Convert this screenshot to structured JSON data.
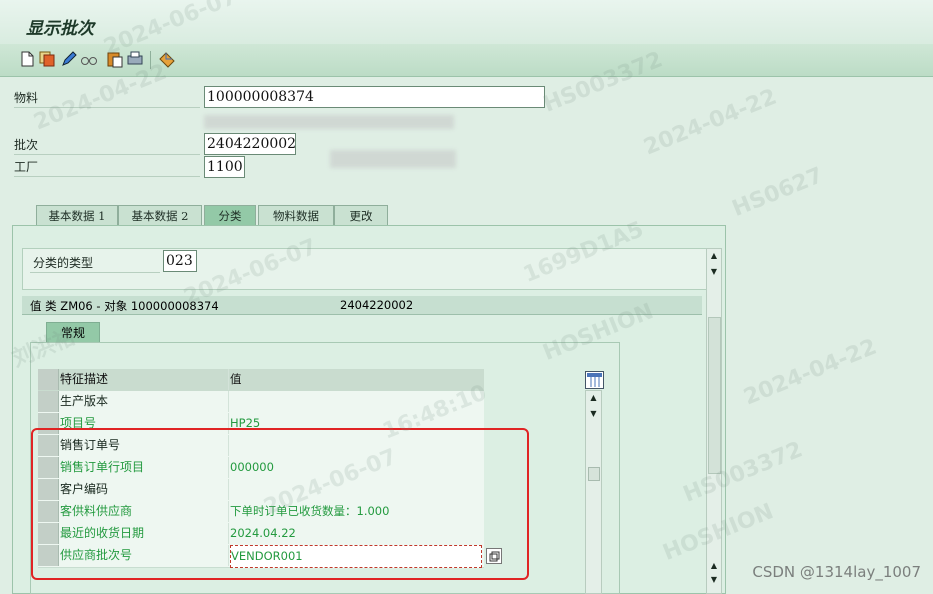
{
  "window": {
    "title": "显示批次"
  },
  "toolbar": {
    "icons": [
      "new-document-icon",
      "copy-icon",
      "pencil-edit-icon",
      "glasses-display-icon",
      "paste-icon",
      "print-icon",
      "transport-icon"
    ]
  },
  "fields": {
    "material": {
      "label": "物料",
      "value": "100000008374"
    },
    "batch": {
      "label": "批次",
      "value": "2404220002"
    },
    "plant": {
      "label": "工厂",
      "value": "1100"
    }
  },
  "tabs": [
    {
      "label": "基本数据 1"
    },
    {
      "label": "基本数据 2"
    },
    {
      "label": "分类"
    },
    {
      "label": "物料数据"
    },
    {
      "label": "更改"
    }
  ],
  "classification": {
    "class_type_label": "分类的类型",
    "class_type_value": "023",
    "object_header_left": "值 类 ZM06 - 对象 100000008374",
    "object_header_right": "2404220002",
    "subtab": "常规",
    "grid": {
      "headers": [
        "特征描述",
        "值"
      ],
      "rows": [
        {
          "desc": "生产版本",
          "value": ""
        },
        {
          "desc": "项目号",
          "value": "HP25"
        },
        {
          "desc": "销售订单号",
          "value": ""
        },
        {
          "desc": "销售订单行项目",
          "value": "000000"
        },
        {
          "desc": "客户编码",
          "value": ""
        },
        {
          "desc": "客供料供应商",
          "value": "下单时订单已收货数量：1.000"
        },
        {
          "desc": "最近的收货日期",
          "value": "2024.04.22"
        },
        {
          "desc": "供应商批次号",
          "value": "VENDOR001"
        }
      ]
    }
  },
  "watermarks": [
    "2024-04-22",
    "HS003372",
    "HOSHION",
    "刘洪裕",
    "2024-06-07",
    "16:48:10",
    "HS0627",
    "1699D1A5"
  ],
  "credit": "CSDN @1314lay_1007",
  "colors": {
    "highlight_border": "#e02424",
    "green_text": "#239a3f",
    "header_bg": "#c9dccf"
  }
}
